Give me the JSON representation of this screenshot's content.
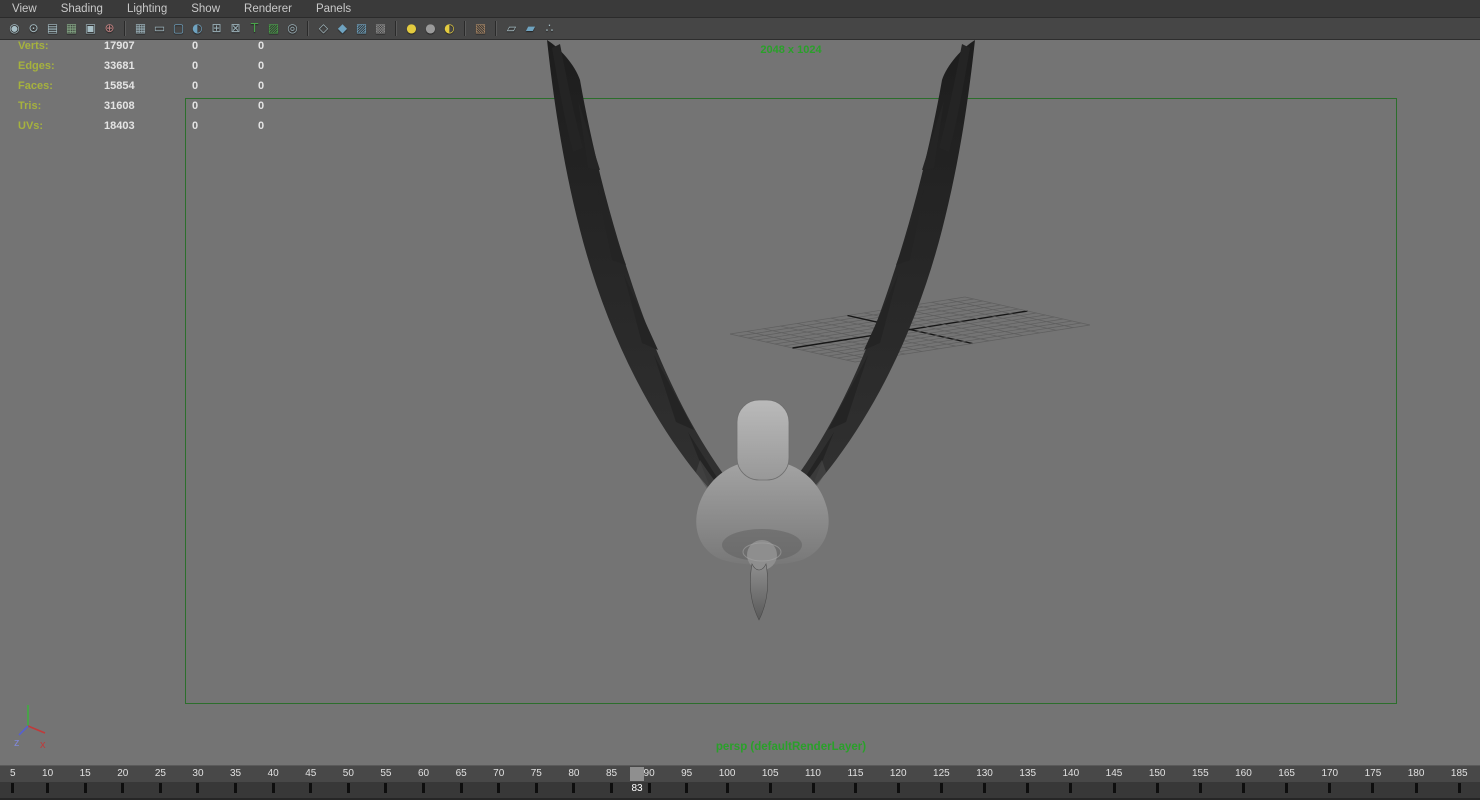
{
  "menu_bar": {
    "items": [
      {
        "name": "menu-view",
        "label": "View"
      },
      {
        "name": "menu-shading",
        "label": "Shading"
      },
      {
        "name": "menu-lighting",
        "label": "Lighting"
      },
      {
        "name": "menu-show",
        "label": "Show"
      },
      {
        "name": "menu-renderer",
        "label": "Renderer"
      },
      {
        "name": "menu-panels",
        "label": "Panels"
      }
    ]
  },
  "toolbar": {
    "groups": [
      [
        {
          "name": "select-camera-icon",
          "glyph": "◉",
          "color": "#a8bfc6"
        },
        {
          "name": "lock-camera-icon",
          "glyph": "⊙",
          "color": "#a8bfc6"
        },
        {
          "name": "camera-attributes-icon",
          "glyph": "▤",
          "color": "#a8bfc6"
        },
        {
          "name": "bookmarks-icon",
          "glyph": "▦",
          "color": "#86a886"
        },
        {
          "name": "image-plane-icon",
          "glyph": "▣",
          "color": "#a8bfc6"
        },
        {
          "name": "pan-zoom-icon",
          "glyph": "⊕",
          "color": "#c08080"
        }
      ],
      [
        {
          "name": "grid-icon",
          "glyph": "▦",
          "color": "#9ab0b8"
        },
        {
          "name": "film-gate-icon",
          "glyph": "▭",
          "color": "#9ab0b8"
        },
        {
          "name": "resolution-gate-icon",
          "glyph": "▢",
          "color": "#6fa3c0"
        },
        {
          "name": "gate-mask-icon",
          "glyph": "◐",
          "color": "#6fa3c0"
        },
        {
          "name": "field-chart-icon",
          "glyph": "⊞",
          "color": "#9ab0b8"
        },
        {
          "name": "safe-action-icon",
          "glyph": "⊠",
          "color": "#9ab0b8"
        },
        {
          "name": "safe-title-icon",
          "glyph": "T",
          "color": "#4aa44a"
        },
        {
          "name": "texture-view-icon",
          "glyph": "▨",
          "color": "#4aa44a"
        },
        {
          "name": "snapshot-icon",
          "glyph": "◎",
          "color": "#9ab0b8"
        }
      ],
      [
        {
          "name": "wireframe-icon",
          "glyph": "◇",
          "color": "#a8bfc6"
        },
        {
          "name": "smooth-shade-icon",
          "glyph": "◆",
          "color": "#6fa3c0"
        },
        {
          "name": "textured-icon",
          "glyph": "▨",
          "color": "#6fa3c0"
        },
        {
          "name": "checker-icon",
          "glyph": "▩",
          "color": "#8a8a8a"
        }
      ],
      [
        {
          "name": "all-lights-icon",
          "glyph": "●",
          "color": "#e3cb3f"
        },
        {
          "name": "no-lights-icon",
          "glyph": "●",
          "color": "#9a9a9a"
        },
        {
          "name": "default-light-icon",
          "glyph": "◐",
          "color": "#e3cb3f"
        }
      ],
      [
        {
          "name": "isolate-select-icon",
          "glyph": "▧",
          "color": "#aa8866"
        }
      ],
      [
        {
          "name": "xray-icon",
          "glyph": "▱",
          "color": "#a8bfc6"
        },
        {
          "name": "xray-joints-icon",
          "glyph": "▰",
          "color": "#6fa3c0"
        },
        {
          "name": "node-connections-icon",
          "glyph": "∴",
          "color": "#a8bfc6"
        }
      ]
    ]
  },
  "hud": {
    "rows": [
      {
        "label": "Verts:",
        "value": "17907",
        "col2": "0",
        "col3": "0"
      },
      {
        "label": "Edges:",
        "value": "33681",
        "col2": "0",
        "col3": "0"
      },
      {
        "label": "Faces:",
        "value": "15854",
        "col2": "0",
        "col3": "0"
      },
      {
        "label": "Tris:",
        "value": "31608",
        "col2": "0",
        "col3": "0"
      },
      {
        "label": "UVs:",
        "value": "18403",
        "col2": "0",
        "col3": "0"
      }
    ]
  },
  "viewport": {
    "resolution_label": "2048 x 1024",
    "camera_label": "persp (defaultRenderLayer)"
  },
  "axis_gizmo": {
    "z_label": "z",
    "x_label": "x"
  },
  "timeline": {
    "tick_labels": [
      "5",
      "10",
      "15",
      "20",
      "25",
      "30",
      "35",
      "40",
      "45",
      "50",
      "55",
      "60",
      "65",
      "70",
      "75",
      "80",
      "85",
      "90",
      "95",
      "100",
      "105",
      "110",
      "115",
      "120",
      "125",
      "130",
      "135",
      "140",
      "145",
      "150",
      "155",
      "160",
      "165",
      "170",
      "175",
      "180",
      "185"
    ],
    "current_frame": "83"
  },
  "colors": {
    "annotation_green": "#2aa02a",
    "hud_label_green": "#a6b23e",
    "viewport_bg": "#747474",
    "gate_border_green": "#2c6e2c",
    "chrome_bg": "#3a3a3a"
  }
}
